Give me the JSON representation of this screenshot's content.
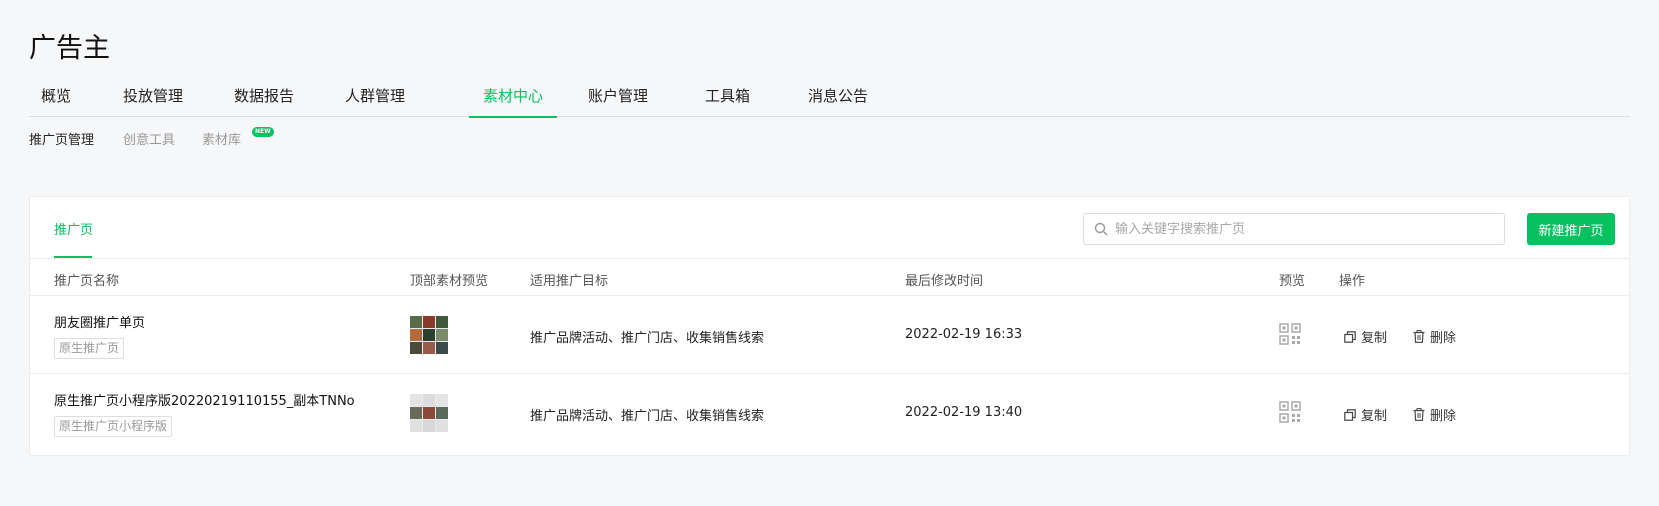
{
  "page": {
    "title": "广告主"
  },
  "main_nav": {
    "tabs": [
      {
        "label": "概览",
        "active": false
      },
      {
        "label": "投放管理",
        "active": false
      },
      {
        "label": "数据报告",
        "active": false
      },
      {
        "label": "人群管理",
        "active": false
      },
      {
        "label": "素材中心",
        "active": true
      },
      {
        "label": "账户管理",
        "active": false
      },
      {
        "label": "工具箱",
        "active": false
      },
      {
        "label": "消息公告",
        "active": false
      }
    ]
  },
  "sub_nav": {
    "items": [
      {
        "label": "推广页管理",
        "active": true
      },
      {
        "label": "创意工具",
        "active": false
      },
      {
        "label": "素材库",
        "active": false,
        "badge": "NEW"
      }
    ]
  },
  "card": {
    "tab_label": "推广页",
    "search": {
      "placeholder": "输入关键字搜索推广页",
      "value": "",
      "icon": "search-icon"
    },
    "new_button_label": "新建推广页",
    "accent_color": "#07c160",
    "columns": [
      "推广页名称",
      "顶部素材预览",
      "适用推广目标",
      "最后修改时间",
      "预览",
      "操作"
    ],
    "rows": [
      {
        "name": "朋友圈推广单页",
        "tag": "原生推广页",
        "thumb_icon": "material-thumbnail",
        "targets": "推广品牌活动、推广门店、收集销售线索",
        "modified": "2022-02-19 16:33",
        "preview_icon": "qrcode-icon",
        "actions": {
          "copy": "复制",
          "delete": "删除"
        }
      },
      {
        "name": "原生推广页小程序版20220219110155_副本TNNo",
        "tag": "原生推广页小程序版",
        "thumb_icon": "material-thumbnail",
        "targets": "推广品牌活动、推广门店、收集销售线索",
        "modified": "2022-02-19 13:40",
        "preview_icon": "qrcode-icon",
        "actions": {
          "copy": "复制",
          "delete": "删除"
        }
      }
    ]
  }
}
